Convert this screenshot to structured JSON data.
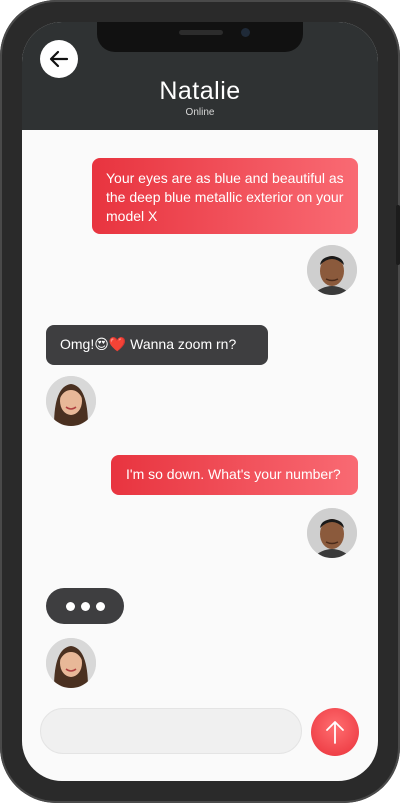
{
  "header": {
    "contact_name": "Natalie",
    "status": "Online"
  },
  "messages": [
    {
      "sender": "me",
      "text": "Your eyes are as blue and beautiful as the deep blue metallic exterior on your model X"
    },
    {
      "sender": "her",
      "text": "Omg!😍❤️ Wanna zoom rn?"
    },
    {
      "sender": "me",
      "text": "I'm so down. What's your number?"
    }
  ],
  "typing_indicator": true,
  "composer": {
    "placeholder": ""
  },
  "icons": {
    "back": "arrow-left-icon",
    "send": "arrow-up-icon"
  },
  "colors": {
    "header_bg": "#2f3233",
    "my_bubble_start": "#e8343f",
    "my_bubble_end": "#f96a73",
    "her_bubble": "#3e3e40",
    "send_button": "#ee3d45"
  }
}
